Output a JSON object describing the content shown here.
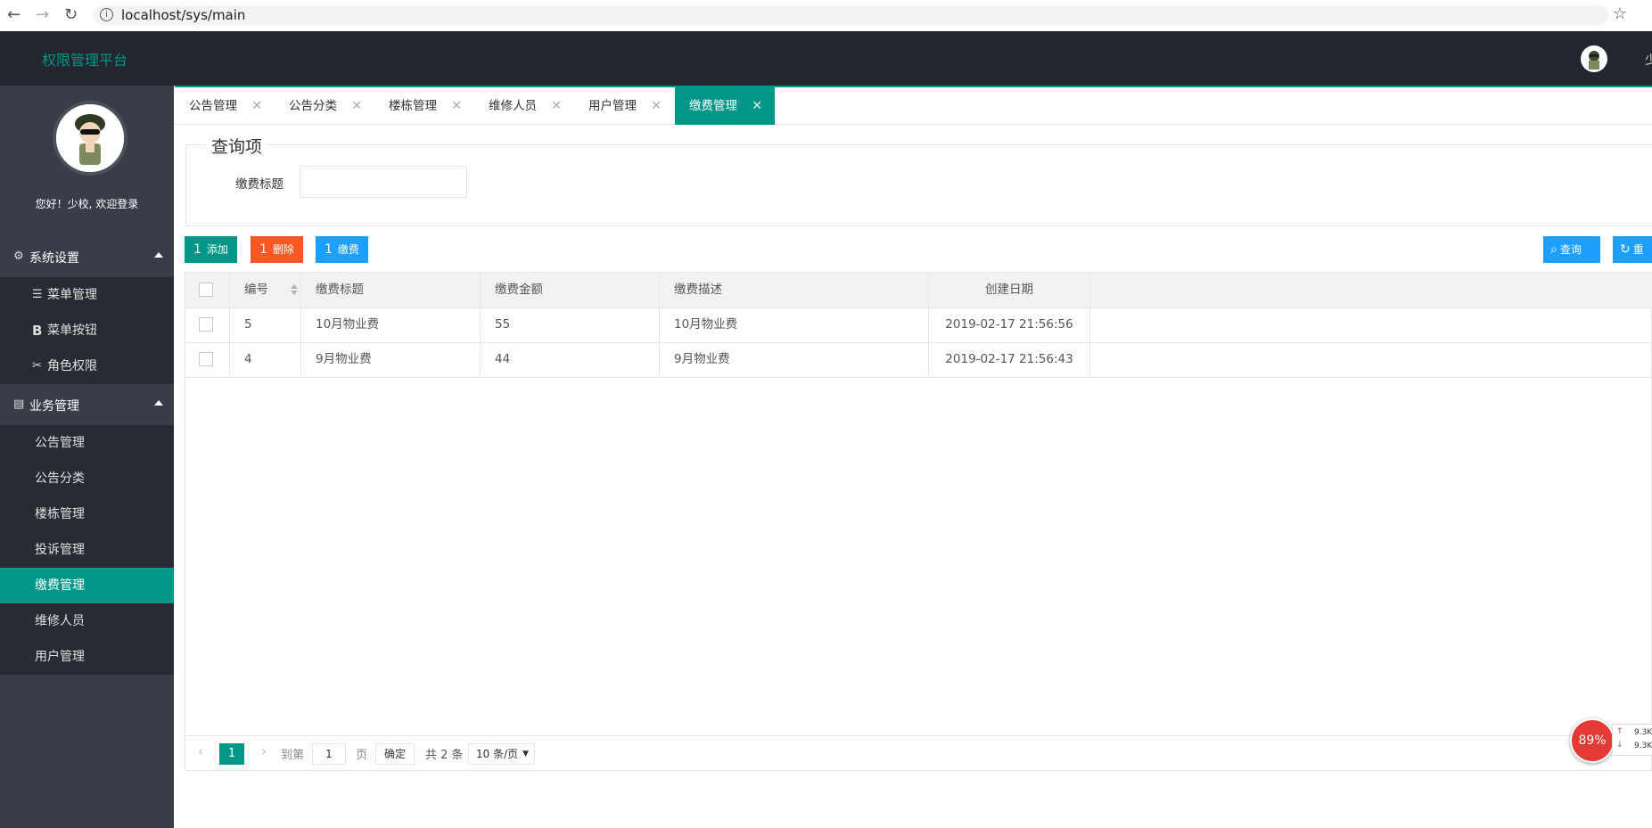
{
  "browser": {
    "url": "localhost/sys/main",
    "icons": [
      "back-arrow-icon",
      "forward-arrow-icon",
      "reload-icon",
      "info-icon",
      "bookmark-star-icon"
    ]
  },
  "header": {
    "brand": "权限管理平台",
    "user_name": "少"
  },
  "sidebar": {
    "welcome": "您好！少校, 欢迎登录",
    "groups": [
      {
        "label": "系统设置",
        "icon": "gear-icon",
        "items": [
          {
            "label": "菜单管理",
            "icon": "list-icon"
          },
          {
            "label": "菜单按钮",
            "icon": "bold-b-icon"
          },
          {
            "label": "角色权限",
            "icon": "tools-icon"
          }
        ]
      },
      {
        "label": "业务管理",
        "icon": "document-icon",
        "items": [
          {
            "label": "公告管理"
          },
          {
            "label": "公告分类"
          },
          {
            "label": "楼栋管理"
          },
          {
            "label": "投诉管理"
          },
          {
            "label": "缴费管理",
            "active": true
          },
          {
            "label": "维修人员"
          },
          {
            "label": "用户管理"
          }
        ]
      }
    ]
  },
  "tabs": [
    {
      "label": "公告管理"
    },
    {
      "label": "公告分类"
    },
    {
      "label": "楼栋管理"
    },
    {
      "label": "维修人员"
    },
    {
      "label": "用户管理"
    },
    {
      "label": "缴费管理",
      "active": true
    }
  ],
  "query": {
    "legend": "查询项",
    "field_label": "缴费标题",
    "field_value": ""
  },
  "toolbar": {
    "add": "添加",
    "delete": "删除",
    "pay": "缴费",
    "search": "查询",
    "reset": "重",
    "btn_icon_glyph": "1",
    "colors": {
      "add": "#009688",
      "delete": "#ff5722",
      "pay": "#1e9fff",
      "search": "#1e9fff"
    }
  },
  "table": {
    "columns": [
      "编号",
      "缴费标题",
      "缴费金额",
      "缴费描述",
      "创建日期"
    ],
    "rows": [
      [
        "5",
        "10月物业费",
        "55",
        "10月物业费",
        "2019-02-17 21:56:56"
      ],
      [
        "4",
        "9月物业费",
        "44",
        "9月物业费",
        "2019-02-17 21:56:43"
      ]
    ]
  },
  "pager": {
    "current_page": "1",
    "goto_label": "到第",
    "goto_value": "1",
    "page_unit": "页",
    "confirm": "确定",
    "total": "共 2 条",
    "page_size": "10 条/页"
  },
  "net_widget": {
    "percent": "89%",
    "up": "9.3K",
    "down": "9.3K"
  },
  "colors": {
    "accent": "#009688",
    "header_bg": "#23262e",
    "sidebar_bg": "#393d49",
    "submenu_bg": "#282b33"
  }
}
